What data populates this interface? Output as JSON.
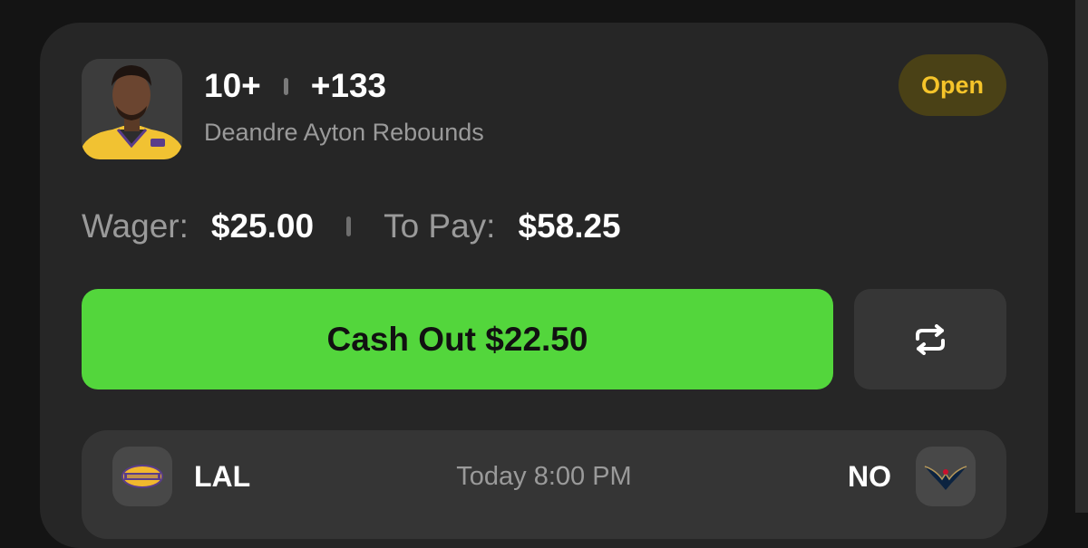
{
  "bet": {
    "line": "10+",
    "odds": "+133",
    "market": "Deandre Ayton Rebounds",
    "status": "Open",
    "wager_label": "Wager:",
    "wager_value": "$25.00",
    "payout_label": "To Pay:",
    "payout_value": "$58.25",
    "cashout_label": "Cash Out $22.50"
  },
  "game": {
    "away_team": "LAL",
    "time": "Today 8:00 PM",
    "home_team": "NO"
  },
  "icons": {
    "share": "repeat-arrows-icon",
    "avatar": "player-headshot",
    "away_logo": "lakers-logo",
    "home_logo": "pelicans-logo"
  },
  "colors": {
    "background": "#141414",
    "card": "#262626",
    "cashout_green": "#53d63c",
    "status_text": "#f5c42a",
    "status_bg": "#4a4116"
  }
}
